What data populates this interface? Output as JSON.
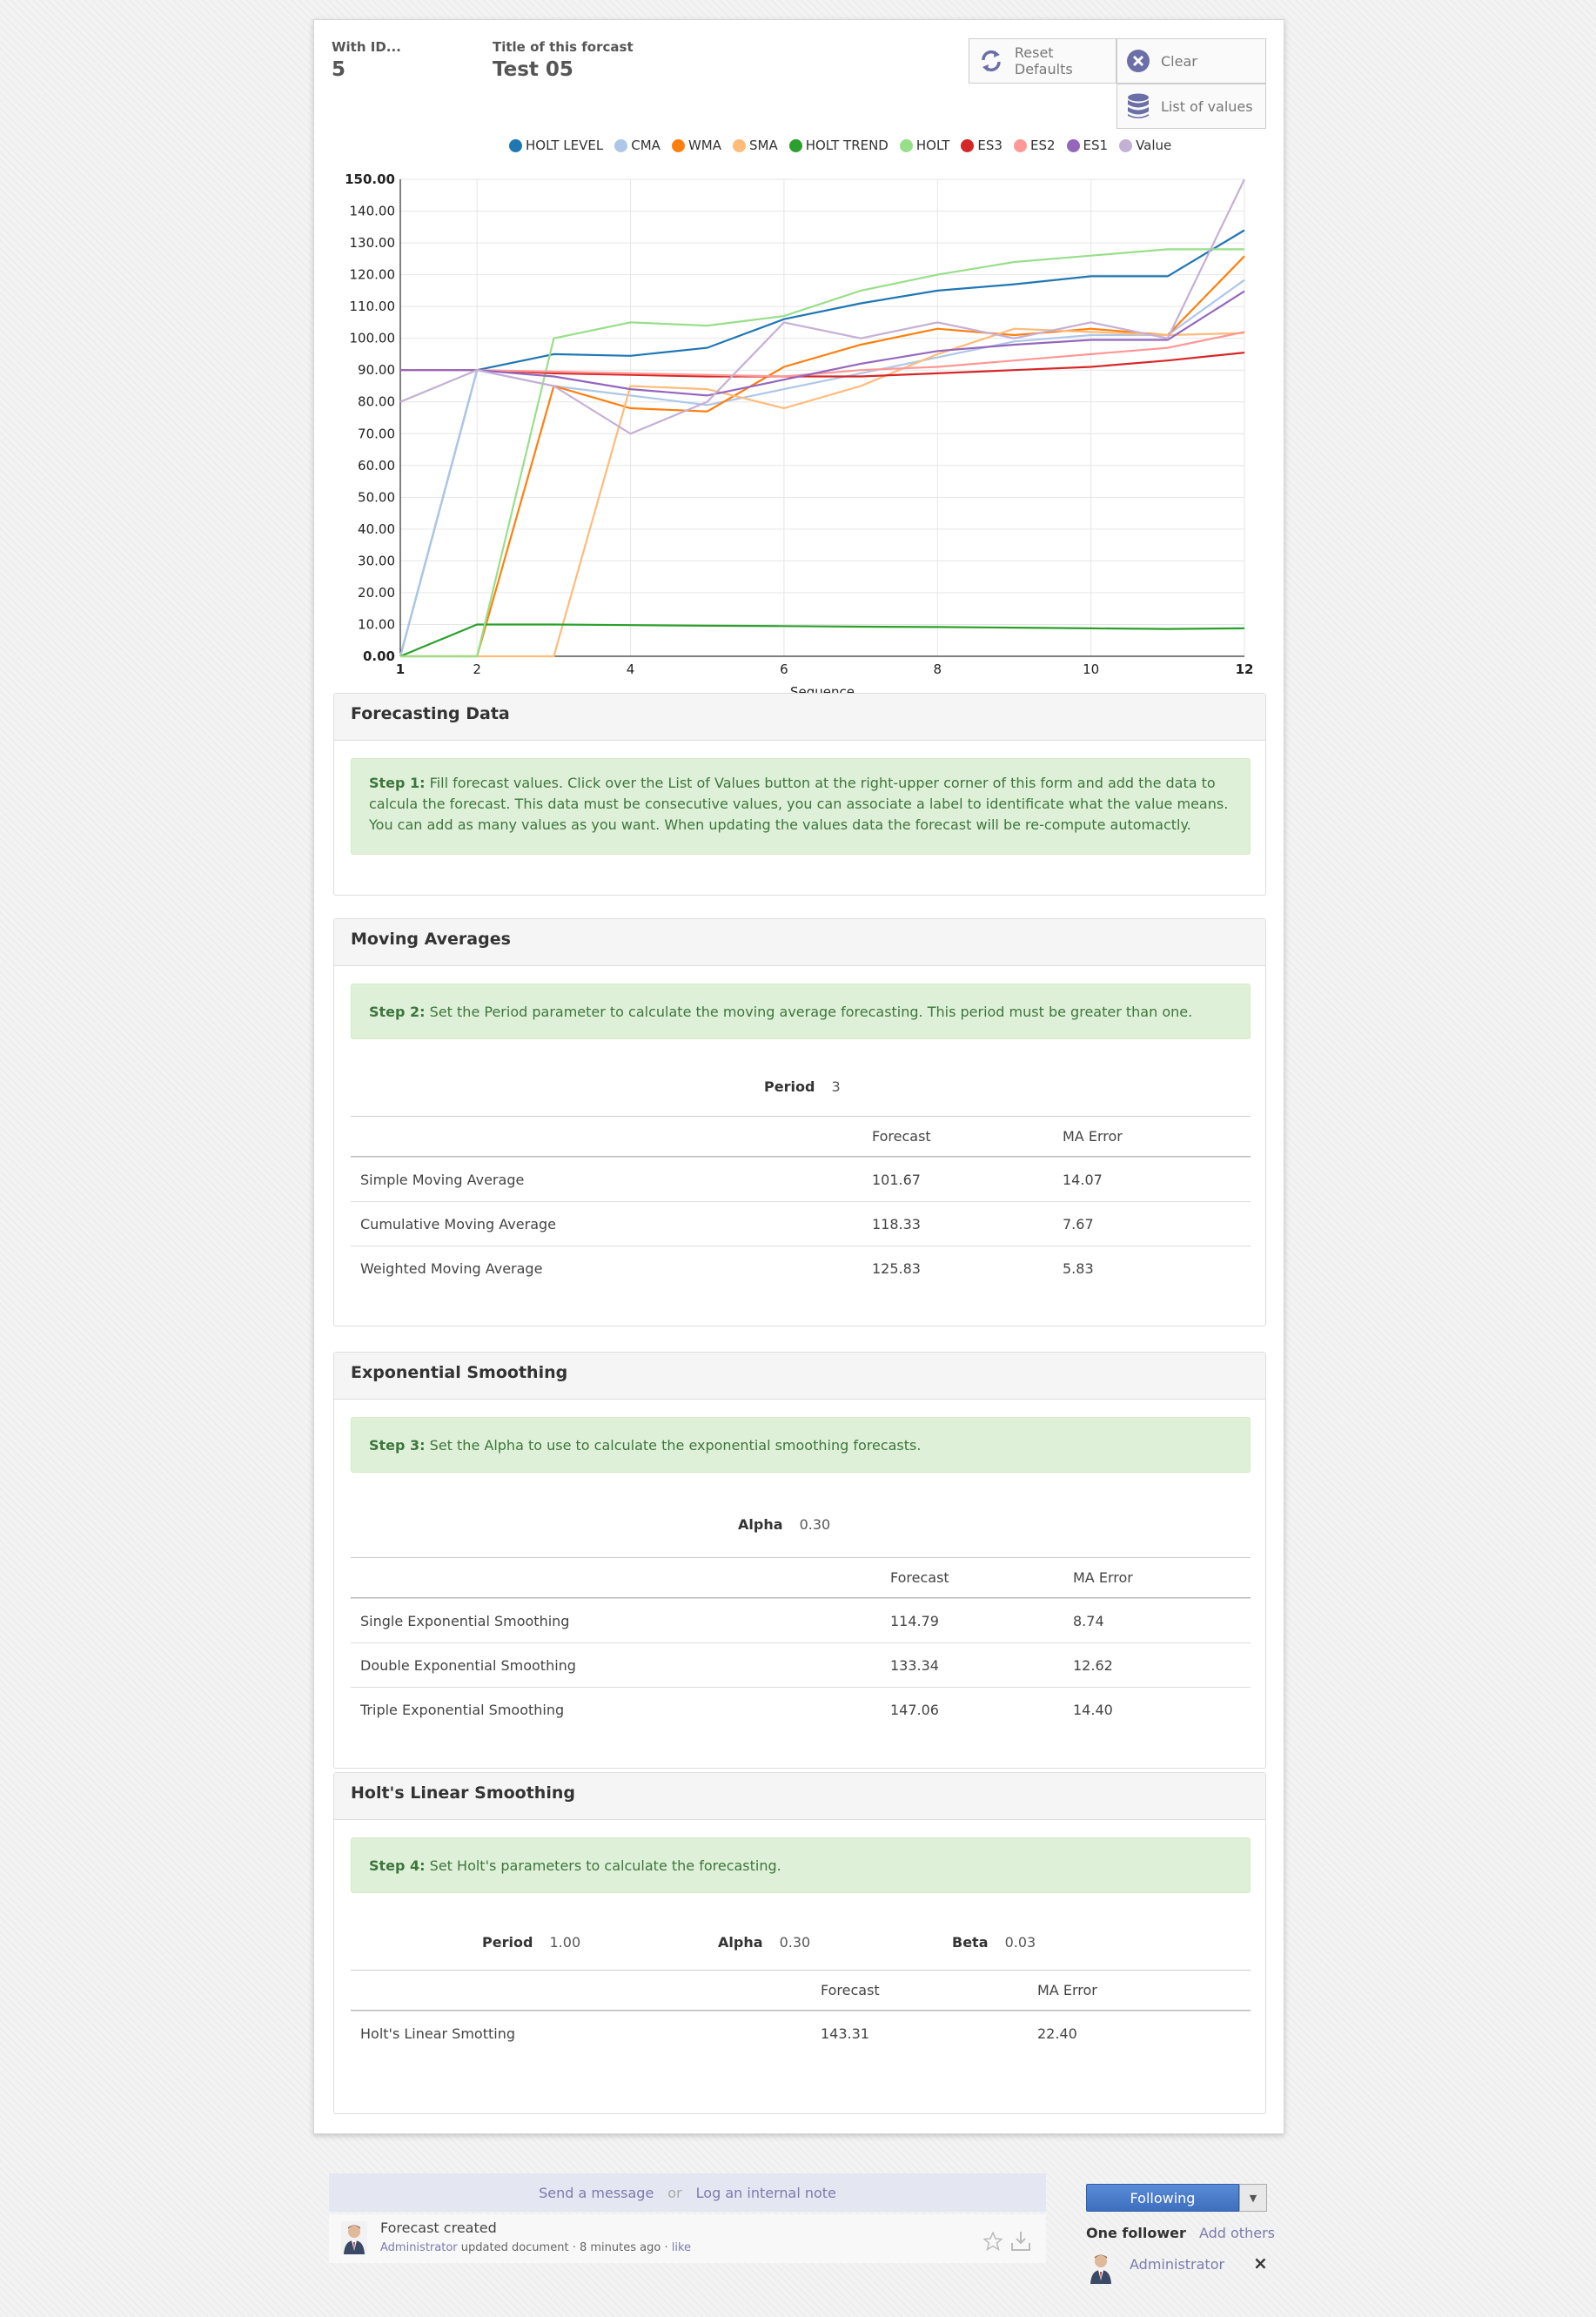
{
  "header": {
    "id_label": "With ID...",
    "id_value": "5",
    "title_label": "Title of this forcast",
    "title_value": "Test 05"
  },
  "buttons": {
    "reset": "Reset Defaults",
    "clear": "Clear",
    "list_values": "List of values"
  },
  "chart_data": {
    "type": "line",
    "xlabel": "Sequence",
    "xlim": [
      1,
      12
    ],
    "ylim": [
      0,
      150
    ],
    "x_ticks": [
      "1",
      "2",
      "4",
      "6",
      "8",
      "10",
      "12"
    ],
    "y_ticks": [
      "0.00",
      "10.00",
      "20.00",
      "30.00",
      "40.00",
      "50.00",
      "60.00",
      "70.00",
      "80.00",
      "90.00",
      "100.00",
      "110.00",
      "120.00",
      "130.00",
      "140.00",
      "150.00"
    ],
    "legend_position": "top",
    "grid": true,
    "x": [
      1,
      2,
      3,
      4,
      5,
      6,
      7,
      8,
      9,
      10,
      11,
      12
    ],
    "series": [
      {
        "name": "HOLT LEVEL",
        "color": "#1f77b4",
        "values": [
          0,
          90,
          95,
          94.5,
          97,
          106,
          111,
          115,
          117,
          119.5,
          119.5,
          134
        ]
      },
      {
        "name": "CMA",
        "color": "#aec7e8",
        "values": [
          0,
          90,
          85,
          82,
          79,
          84,
          89,
          94,
          99,
          101,
          101,
          118.33
        ]
      },
      {
        "name": "WMA",
        "color": "#ff7f0e",
        "values": [
          0,
          0,
          85,
          78,
          77,
          91,
          98,
          103,
          101,
          103,
          101,
          125.83
        ]
      },
      {
        "name": "SMA",
        "color": "#ffbb78",
        "values": [
          0,
          0,
          0,
          85,
          84,
          78,
          85,
          95,
          103,
          102,
          101,
          101.67
        ]
      },
      {
        "name": "HOLT TREND",
        "color": "#2ca02c",
        "values": [
          0,
          10,
          10,
          9.8,
          9.6,
          9.5,
          9.3,
          9.2,
          9,
          8.8,
          8.6,
          8.8
        ]
      },
      {
        "name": "HOLT",
        "color": "#98df8a",
        "values": [
          0,
          0,
          100,
          105,
          104,
          107,
          115,
          120,
          124,
          126,
          128,
          128
        ]
      },
      {
        "name": "ES3",
        "color": "#d62728",
        "values": [
          90,
          90,
          89,
          88.5,
          88,
          88,
          88,
          89,
          90,
          91,
          93,
          95.5
        ]
      },
      {
        "name": "ES2",
        "color": "#ff9896",
        "values": [
          90,
          90,
          89.5,
          89,
          88.5,
          88,
          90,
          91,
          93,
          95,
          97,
          102
        ]
      },
      {
        "name": "ES1",
        "color": "#9467bd",
        "values": [
          90,
          90,
          88,
          84,
          82,
          87,
          92,
          96,
          98,
          99.5,
          99.5,
          114.79
        ]
      },
      {
        "name": "Value",
        "color": "#c5b0d5",
        "values": [
          80,
          90,
          85,
          70,
          80,
          105,
          100,
          105,
          100,
          105,
          100,
          150
        ]
      }
    ]
  },
  "forecasting_data": {
    "title": "Forecasting Data",
    "step_label": "Step 1:",
    "step_text": "Fill forecast values. Click over the List of Values button at the right-upper corner of this form and add the data to calcula the forecast. This data must be consecutive values, you can associate a label to identificate what the value means. You can add as many values as you want. When updating the values data the forecast will be re-compute automactly."
  },
  "moving_averages": {
    "title": "Moving Averages",
    "step_label": "Step 2:",
    "step_text": "Set the Period parameter to calculate the moving average forecasting. This period must be greater than one.",
    "period_label": "Period",
    "period_value": "3",
    "col_forecast": "Forecast",
    "col_error": "MA Error",
    "rows": [
      {
        "name": "Simple Moving Average",
        "forecast": "101.67",
        "error": "14.07"
      },
      {
        "name": "Cumulative Moving Average",
        "forecast": "118.33",
        "error": "7.67"
      },
      {
        "name": "Weighted Moving Average",
        "forecast": "125.83",
        "error": "5.83"
      }
    ]
  },
  "exponential_smoothing": {
    "title": "Exponential Smoothing",
    "step_label": "Step 3:",
    "step_text": "Set the Alpha to use to calculate the exponential smoothing forecasts.",
    "alpha_label": "Alpha",
    "alpha_value": "0.30",
    "col_forecast": "Forecast",
    "col_error": "MA Error",
    "rows": [
      {
        "name": "Single Exponential Smoothing",
        "forecast": "114.79",
        "error": "8.74"
      },
      {
        "name": "Double Exponential Smoothing",
        "forecast": "133.34",
        "error": "12.62"
      },
      {
        "name": "Triple Exponential Smoothing",
        "forecast": "147.06",
        "error": "14.40"
      }
    ]
  },
  "holt": {
    "title": "Holt's Linear Smoothing",
    "step_label": "Step 4:",
    "step_text": "Set Holt's parameters to calculate the forecasting.",
    "period_label": "Period",
    "period_value": "1.00",
    "alpha_label": "Alpha",
    "alpha_value": "0.30",
    "beta_label": "Beta",
    "beta_value": "0.03",
    "col_forecast": "Forecast",
    "col_error": "MA Error",
    "rows": [
      {
        "name": "Holt's Linear Smotting",
        "forecast": "143.31",
        "error": "22.40"
      }
    ]
  },
  "chatter": {
    "send_message": "Send a message",
    "or": "or",
    "log_note": "Log an internal note",
    "message_title": "Forecast created",
    "message_author": "Administrator",
    "message_action": "updated document",
    "message_time": "8 minutes ago",
    "message_like": "like",
    "following_label": "Following",
    "followers_count": "One follower",
    "add_others": "Add others",
    "follower_name": "Administrator",
    "remove_follower": "×"
  },
  "colors": {
    "link": "#7c7bad",
    "step_bg": "#dff0d8",
    "step_text": "#3c763d",
    "follow_button": "#3c6fbf"
  }
}
